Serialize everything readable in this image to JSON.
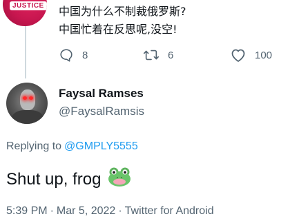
{
  "parent_tweet": {
    "avatar_badge": "JUSTICE",
    "lines": [
      "中国为什么不制裁俄罗斯?",
      "中国忙着在反思呢,没空!"
    ],
    "reply_count": "8",
    "retweet_count": "6",
    "like_count": "100"
  },
  "tweet": {
    "author_name": "Faysal Ramses",
    "author_handle": "@FaysalRamsis",
    "replying_label": "Replying to",
    "replying_mention": "@GMPLY5555",
    "text": "Shut up, frog",
    "emoji": "frog-face",
    "time": "5:39 PM",
    "date": "Mar 5, 2022",
    "source": "Twitter for Android",
    "separator": "·"
  },
  "colors": {
    "text": "#0f1419",
    "muted": "#536471",
    "link": "#1d9bf0",
    "thread_line": "#cfd9de"
  },
  "icons": [
    "reply-icon",
    "retweet-icon",
    "like-icon",
    "frog-emoji-icon"
  ]
}
